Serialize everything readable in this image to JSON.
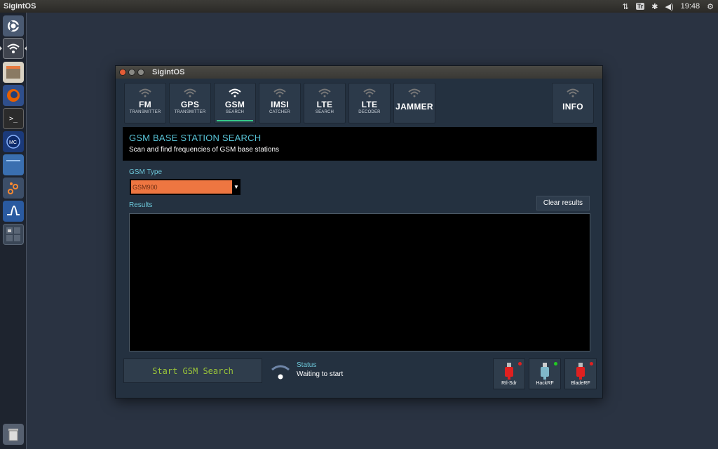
{
  "topbar": {
    "app_title": "SigintOS",
    "keyboard_badge": "Tr",
    "time": "19:48"
  },
  "launcher": {
    "items": [
      {
        "name": "dash-home",
        "icon": "ubuntu-logo-icon"
      },
      {
        "name": "sigintos-wifi",
        "icon": "wifi-icon",
        "active": true
      },
      {
        "name": "files",
        "icon": "file-cabinet-icon"
      },
      {
        "name": "firefox",
        "icon": "firefox-icon"
      },
      {
        "name": "terminal",
        "icon": "terminal-icon"
      },
      {
        "name": "app-mc",
        "icon": "mc-icon"
      },
      {
        "name": "app-blue",
        "icon": "blue-app-icon"
      },
      {
        "name": "app-gnuradio",
        "icon": "gnuradio-icon"
      },
      {
        "name": "app-scope",
        "icon": "waveform-icon"
      },
      {
        "name": "workspace-switcher",
        "icon": "workspaces-icon"
      },
      {
        "name": "trash",
        "icon": "trash-icon"
      }
    ]
  },
  "window": {
    "title": "SigintOS",
    "tabs": [
      {
        "main": "FM",
        "sub": "TRANSMITTER",
        "wifi": true
      },
      {
        "main": "GPS",
        "sub": "TRANSMITTER",
        "wifi": true
      },
      {
        "main": "GSM",
        "sub": "SEARCH",
        "wifi": true,
        "active": true
      },
      {
        "main": "IMSI",
        "sub": "CATCHER",
        "wifi": true
      },
      {
        "main": "LTE",
        "sub": "SEARCH",
        "wifi": true
      },
      {
        "main": "LTE",
        "sub": "DECODER",
        "wifi": true
      },
      {
        "main": "JAMMER",
        "sub": "",
        "wifi": true
      },
      {
        "main": "INFO",
        "sub": "",
        "wifi": true
      }
    ],
    "header": {
      "title": "GSM BASE STATION SEARCH",
      "subtitle": "Scan and find frequencies of GSM base stations"
    },
    "gsm_type": {
      "label": "GSM Type",
      "selected": "GSM900"
    },
    "results": {
      "label": "Results",
      "clear_label": "Clear results"
    },
    "start_label": "Start GSM Search",
    "status": {
      "label": "Status",
      "text": "Waiting to start"
    },
    "devices": [
      {
        "name": "Rtl-Sdr",
        "status_color": "#e02020",
        "icon_color": "#e02020"
      },
      {
        "name": "HackRF",
        "status_color": "#22cc22",
        "icon_color": "#7fb8c9"
      },
      {
        "name": "BladeRF",
        "status_color": "#e02020",
        "icon_color": "#e02020"
      }
    ]
  }
}
